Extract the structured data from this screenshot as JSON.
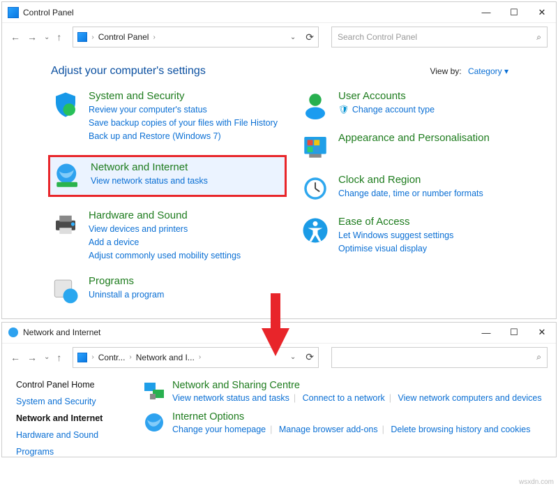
{
  "win1": {
    "title": "Control Panel",
    "crumb": "Control Panel",
    "searchPlaceholder": "Search Control Panel",
    "heading": "Adjust your computer's settings",
    "viewby": "View by:",
    "viewbyVal": "Category ▾",
    "cats": {
      "sys": {
        "name": "System and Security",
        "l1": "Review your computer's status",
        "l2": "Save backup copies of your files with File History",
        "l3": "Back up and Restore (Windows 7)"
      },
      "net": {
        "name": "Network and Internet",
        "l1": "View network status and tasks"
      },
      "hw": {
        "name": "Hardware and Sound",
        "l1": "View devices and printers",
        "l2": "Add a device",
        "l3": "Adjust commonly used mobility settings"
      },
      "prog": {
        "name": "Programs",
        "l1": "Uninstall a program"
      },
      "usr": {
        "name": "User Accounts",
        "l1": "Change account type"
      },
      "app": {
        "name": "Appearance and Personalisation"
      },
      "clk": {
        "name": "Clock and Region",
        "l1": "Change date, time or number formats"
      },
      "eoa": {
        "name": "Ease of Access",
        "l1": "Let Windows suggest settings",
        "l2": "Optimise visual display"
      }
    }
  },
  "win2": {
    "title": "Network and Internet",
    "crumb1": "Contr...",
    "crumb2": "Network and I...",
    "leftnav": {
      "home": "Control Panel Home",
      "a": "System and Security",
      "b": "Network and Internet",
      "c": "Hardware and Sound",
      "d": "Programs"
    },
    "nsc": {
      "title": "Network and Sharing Centre",
      "l1": "View network status and tasks",
      "l2": "Connect to a network",
      "l3": "View network computers and devices"
    },
    "io": {
      "title": "Internet Options",
      "l1": "Change your homepage",
      "l2": "Manage browser add-ons",
      "l3": "Delete browsing history and cookies"
    }
  },
  "watermark": "wsxdn.com"
}
